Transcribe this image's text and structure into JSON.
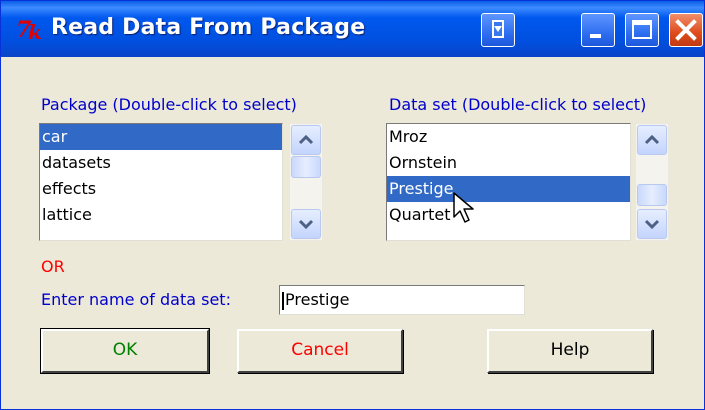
{
  "window": {
    "title": "Read Data From Package",
    "icon": "tk-icon"
  },
  "title_buttons": [
    "dropdown-icon",
    "minimize-icon",
    "maximize-icon",
    "close-icon"
  ],
  "package_list": {
    "label": "Package (Double-click to select)",
    "items": [
      "car",
      "datasets",
      "effects",
      "lattice"
    ],
    "selected_index": 0
  },
  "dataset_list": {
    "label": "Data set (Double-click to select)",
    "items": [
      "Mroz",
      "Ornstein",
      "Prestige",
      "Quartet"
    ],
    "selected_index": 2
  },
  "or_label": "OR",
  "dataset_entry": {
    "label": "Enter name of data set:",
    "value": "Prestige"
  },
  "buttons": {
    "ok": "OK",
    "cancel": "Cancel",
    "help": "Help"
  },
  "colors": {
    "title_bar": "#0054e3",
    "label_blue": "#0000cc",
    "or_red": "#ff0000",
    "ok_green": "#008000",
    "cancel_red": "#ff0000",
    "selection": "#3169c6",
    "face": "#ece9d8"
  }
}
